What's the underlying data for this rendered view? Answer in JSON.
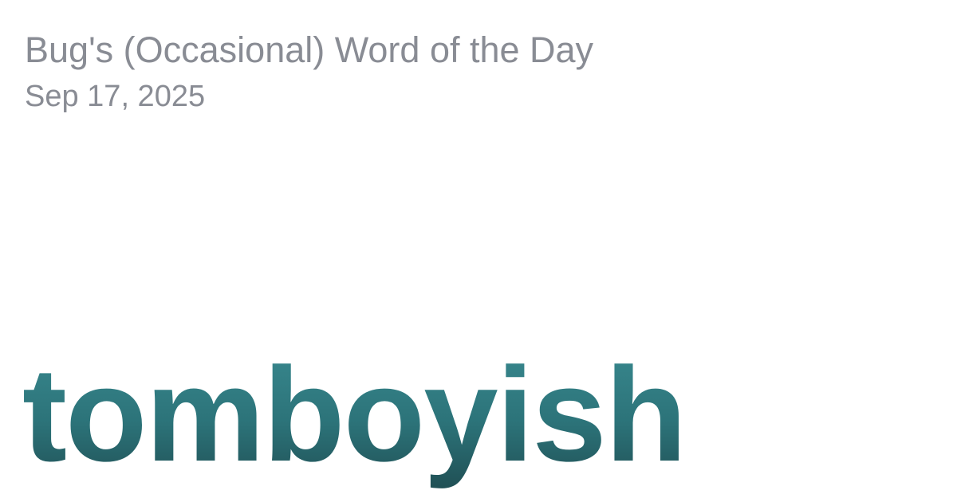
{
  "header": {
    "title": "Bug's (Occasional) Word of the Day",
    "date": "Sep 17, 2025"
  },
  "main": {
    "word": "tomboyish"
  },
  "colors": {
    "meta_text": "#898c94",
    "word_top": "#3a8b91",
    "word_bottom": "#1f4d52",
    "background": "#ffffff"
  }
}
